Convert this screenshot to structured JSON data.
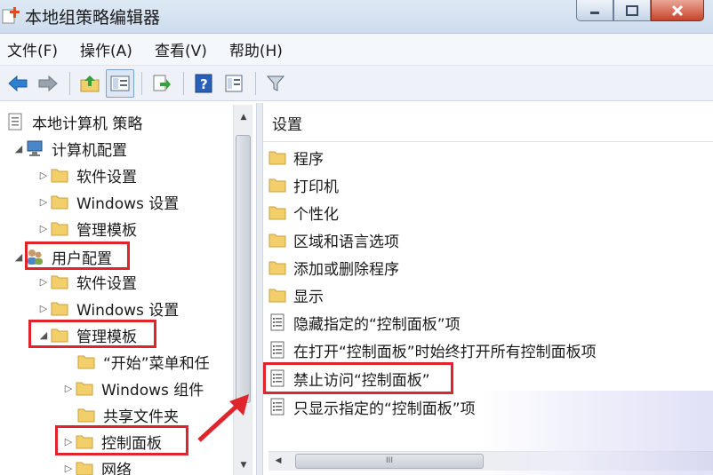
{
  "window": {
    "title": "本地组策略编辑器"
  },
  "menu": [
    "文件(F)",
    "操作(A)",
    "查看(V)",
    "帮助(H)"
  ],
  "toolbar": {
    "buttons": [
      "back-arrow-icon",
      "forward-arrow-icon",
      "up-folder-icon",
      "show-hide-tree-icon",
      "export-list-icon",
      "help-icon",
      "properties-icon",
      "filter-icon"
    ]
  },
  "tree": {
    "root": "本地计算机 策略",
    "computer_config": "计算机配置",
    "cc_software": "软件设置",
    "cc_windows": "Windows 设置",
    "cc_admin": "管理模板",
    "user_config": "用户配置",
    "uc_software": "软件设置",
    "uc_windows": "Windows 设置",
    "uc_admin": "管理模板",
    "start_menu": "“开始”菜单和任",
    "win_components": "Windows 组件",
    "shared_folders": "共享文件夹",
    "control_panel": "控制面板",
    "network": "网络"
  },
  "list": {
    "header": "设置",
    "items": [
      {
        "label": "程序",
        "type": "folder"
      },
      {
        "label": "打印机",
        "type": "folder"
      },
      {
        "label": "个性化",
        "type": "folder"
      },
      {
        "label": "区域和语言选项",
        "type": "folder"
      },
      {
        "label": "添加或删除程序",
        "type": "folder"
      },
      {
        "label": "显示",
        "type": "folder"
      },
      {
        "label": "隐藏指定的“控制面板”项",
        "type": "setting"
      },
      {
        "label": "在打开“控制面板”时始终打开所有控制面板项",
        "type": "setting"
      },
      {
        "label": "禁止访问“控制面板”",
        "type": "setting"
      },
      {
        "label": "只显示指定的“控制面板”项",
        "type": "setting"
      }
    ]
  },
  "colors": {
    "highlight": "#e0242c",
    "folder": "#f2cf6a"
  }
}
